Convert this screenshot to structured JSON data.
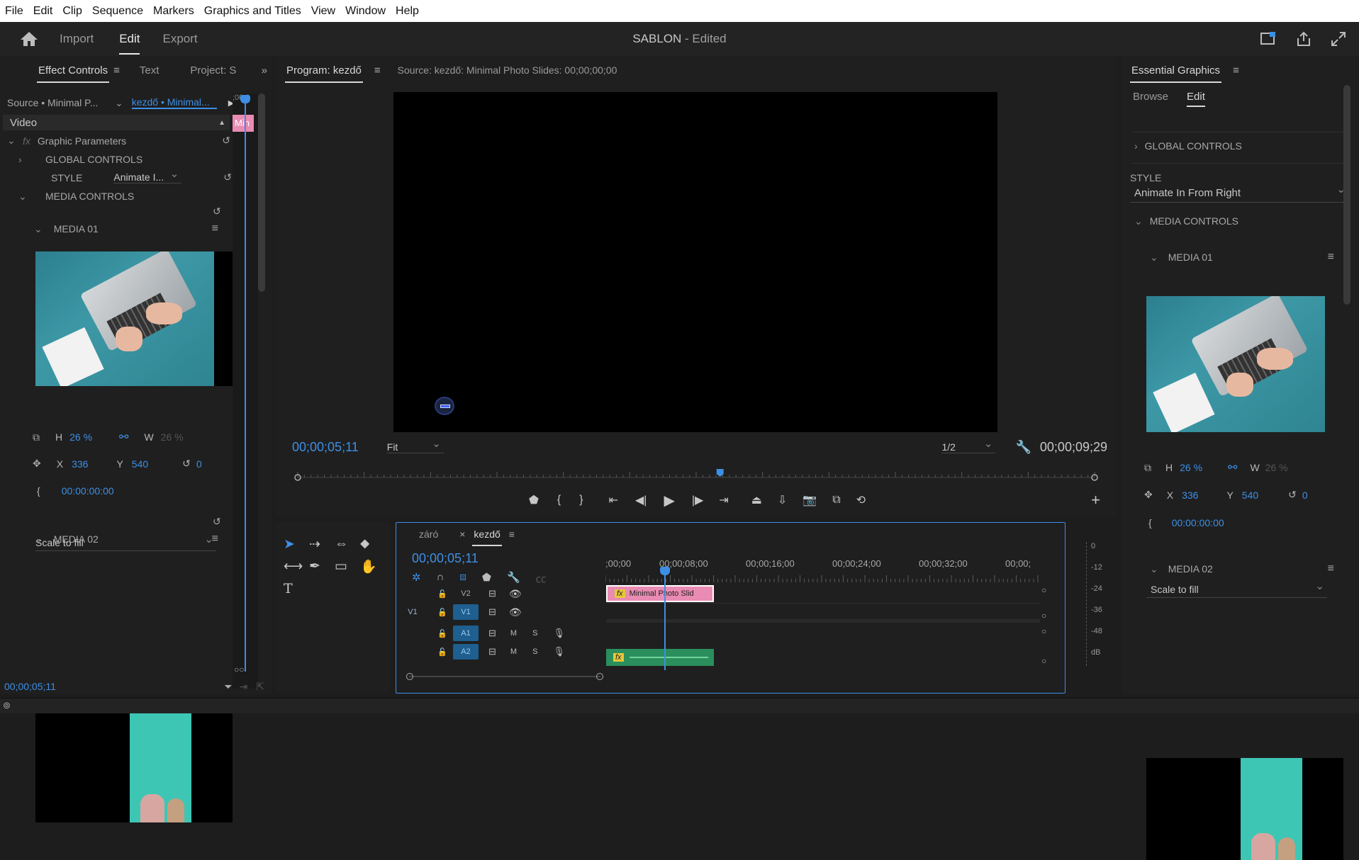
{
  "menubar": [
    "File",
    "Edit",
    "Clip",
    "Sequence",
    "Markers",
    "Graphics and Titles",
    "View",
    "Window",
    "Help"
  ],
  "header": {
    "tabs": [
      {
        "label": "Import",
        "active": false
      },
      {
        "label": "Edit",
        "active": true
      },
      {
        "label": "Export",
        "active": false
      }
    ],
    "project_name": "SABLON",
    "project_status": " - Edited"
  },
  "effect_controls": {
    "tabs": [
      "Effect Controls",
      "Text",
      "Project: S"
    ],
    "source_label": "Source • Minimal P...",
    "sequence_label": "kezdő • Minimal...",
    "mini_clip": "Min",
    "video_label": "Video",
    "graphic_parameters": "Graphic Parameters",
    "global_controls": "GLOBAL CONTROLS",
    "style_label": "STYLE",
    "style_value": "Animate I...",
    "media_controls": "MEDIA CONTROLS",
    "media01": "MEDIA 01",
    "media02": "MEDIA 02",
    "scale_mode": "Scale to fill",
    "h_label": "H",
    "h_value": "26 %",
    "w_label": "W",
    "w_value": "26 %",
    "x_label": "X",
    "x_value": "336",
    "y_label": "Y",
    "y_value": "540",
    "rotation_value": "0",
    "time_value": "00:00:00:00",
    "footer_time": "00;00;05;11"
  },
  "program": {
    "tab": "Program: kezdő",
    "source_info": "Source: kezdő: Minimal Photo Slides: 00;00;00;00",
    "current_time": "00;00;05;11",
    "fit": "Fit",
    "resolution": "1/2",
    "duration": "00;00;09;29",
    "playhead_fraction": 0.53
  },
  "timeline": {
    "tabs": [
      "záró",
      "kezdő"
    ],
    "timecode": "00;00;05;11",
    "ruler_labels": [
      ";00;00",
      "00;00;08;00",
      "00;00;16;00",
      "00;00;24;00",
      "00;00;32;00",
      "00;00;"
    ],
    "tracks": [
      {
        "name": "V2",
        "src": "",
        "type": "video"
      },
      {
        "name": "V1",
        "src": "V1",
        "type": "video"
      },
      {
        "name": "A1",
        "src": "",
        "type": "audio"
      },
      {
        "name": "A2",
        "src": "",
        "type": "audio"
      }
    ],
    "m_label": "M",
    "s_label": "S",
    "clip_label": "Minimal Photo Slid",
    "fx": "fx",
    "meter_labels": [
      "0",
      "-12",
      "-24",
      "-36",
      "-48",
      "dB"
    ]
  },
  "essential_graphics": {
    "title": "Essential Graphics",
    "tabs": [
      "Browse",
      "Edit"
    ],
    "global_controls": "GLOBAL CONTROLS",
    "style_label": "STYLE",
    "style_value": "Animate In From Right",
    "media_controls": "MEDIA CONTROLS",
    "media01": "MEDIA 01",
    "media02": "MEDIA 02",
    "scale_mode": "Scale to fill",
    "h_value": "26 %",
    "w_value": "26 %",
    "x_value": "336",
    "y_value": "540",
    "rotation_value": "0",
    "time_value": "00:00:00:00"
  },
  "colors": {
    "accent": "#3d8fe6",
    "clip_pink": "#e98bb2",
    "clip_green": "#2a8f5c",
    "track_blue": "#1e5f8f"
  }
}
